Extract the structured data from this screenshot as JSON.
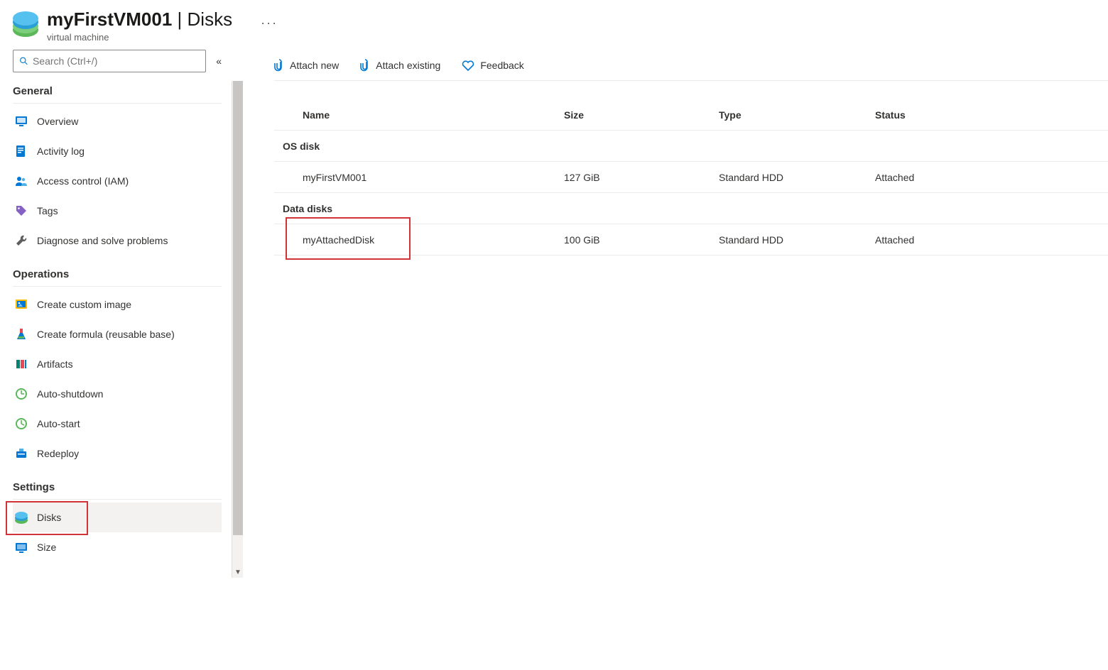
{
  "header": {
    "resource_name": "myFirstVM001",
    "separator": " | ",
    "section": "Disks",
    "subtitle": "virtual machine",
    "more": "···"
  },
  "sidebar": {
    "search_placeholder": "Search (Ctrl+/)",
    "sections": {
      "general": {
        "title": "General",
        "items": [
          {
            "label": "Overview"
          },
          {
            "label": "Activity log"
          },
          {
            "label": "Access control (IAM)"
          },
          {
            "label": "Tags"
          },
          {
            "label": "Diagnose and solve problems"
          }
        ]
      },
      "operations": {
        "title": "Operations",
        "items": [
          {
            "label": "Create custom image"
          },
          {
            "label": "Create formula (reusable base)"
          },
          {
            "label": "Artifacts"
          },
          {
            "label": "Auto-shutdown"
          },
          {
            "label": "Auto-start"
          },
          {
            "label": "Redeploy"
          }
        ]
      },
      "settings": {
        "title": "Settings",
        "items": [
          {
            "label": "Disks"
          },
          {
            "label": "Size"
          }
        ]
      }
    }
  },
  "toolbar": {
    "attach_new": "Attach new",
    "attach_existing": "Attach existing",
    "feedback": "Feedback"
  },
  "table": {
    "columns": {
      "name": "Name",
      "size": "Size",
      "type": "Type",
      "status": "Status"
    },
    "os_group_label": "OS disk",
    "data_group_label": "Data disks",
    "os_disk": {
      "name": "myFirstVM001",
      "size": "127 GiB",
      "type": "Standard HDD",
      "status": "Attached"
    },
    "data_disks": [
      {
        "name": "myAttachedDisk",
        "size": "100 GiB",
        "type": "Standard HDD",
        "status": "Attached"
      }
    ]
  }
}
